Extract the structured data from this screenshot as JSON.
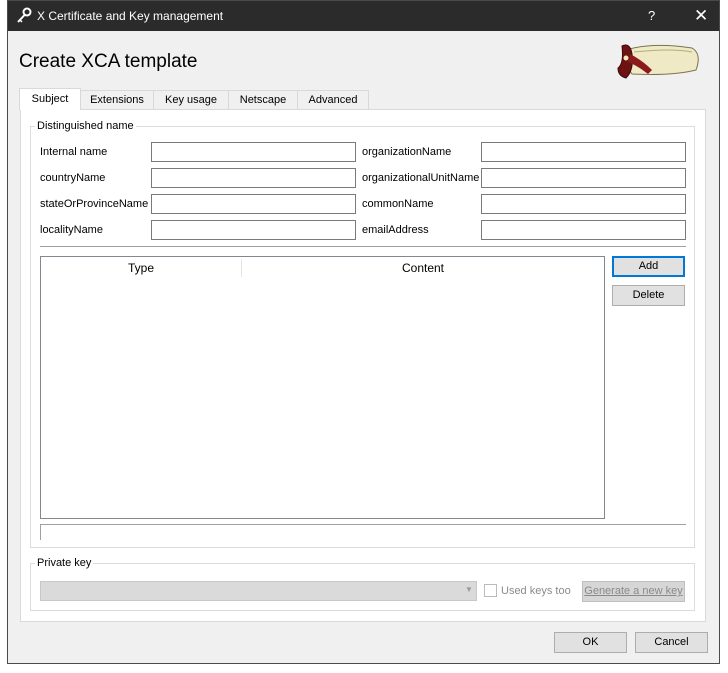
{
  "window": {
    "title": "X Certificate and Key management",
    "help_label": "?",
    "close_label": "✕"
  },
  "heading": "Create XCA template",
  "tabs": [
    "Subject",
    "Extensions",
    "Key usage",
    "Netscape",
    "Advanced"
  ],
  "distinguished_name": {
    "group_label": "Distinguished name",
    "fields_left": [
      {
        "label": "Internal name",
        "value": ""
      },
      {
        "label": "countryName",
        "value": ""
      },
      {
        "label": "stateOrProvinceName",
        "value": ""
      },
      {
        "label": "localityName",
        "value": ""
      }
    ],
    "fields_right": [
      {
        "label": "organizationName",
        "value": ""
      },
      {
        "label": "organizationalUnitName",
        "value": ""
      },
      {
        "label": "commonName",
        "value": ""
      },
      {
        "label": "emailAddress",
        "value": ""
      }
    ]
  },
  "table": {
    "columns": [
      "Type",
      "Content"
    ],
    "rows": []
  },
  "buttons": {
    "add": "Add",
    "delete": "Delete",
    "ok": "OK",
    "cancel": "Cancel"
  },
  "private_key": {
    "group_label": "Private key",
    "selected": "",
    "used_keys_too": "Used keys too",
    "generate": "Generate a new key"
  },
  "icons": {
    "title_icon": "key-icon",
    "logo": "scroll-logo"
  },
  "colors": {
    "titlebar": "#2b2b2b",
    "accent": "#0078d7"
  }
}
